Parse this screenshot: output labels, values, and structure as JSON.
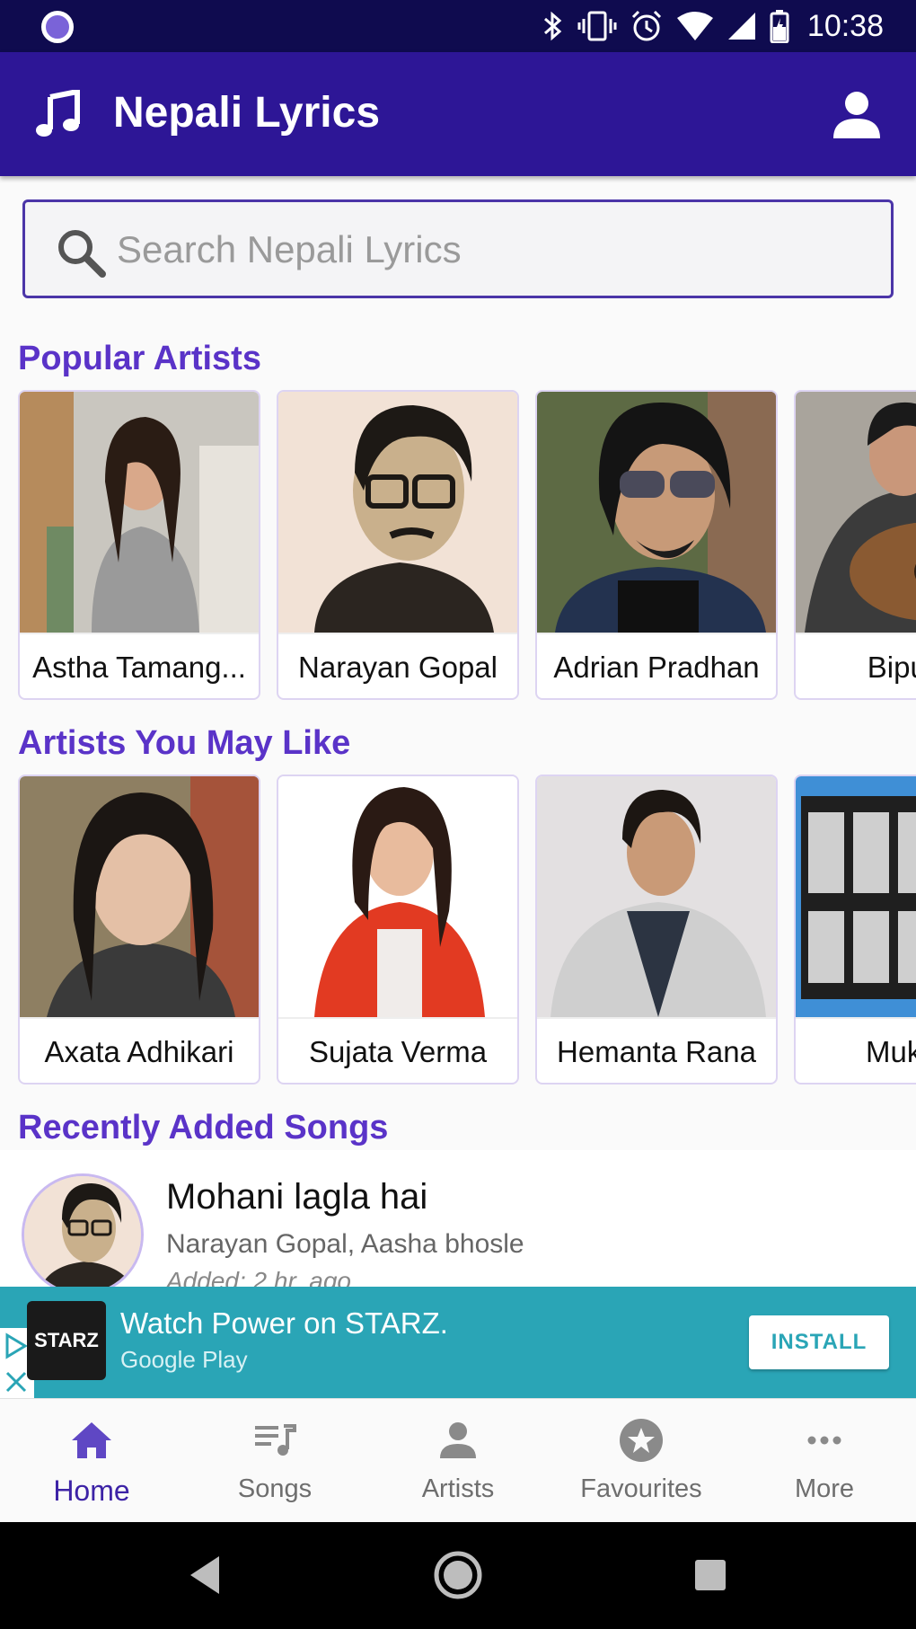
{
  "status_bar": {
    "time": "10:38"
  },
  "app_bar": {
    "title": "Nepali Lyrics"
  },
  "search": {
    "placeholder": "Search Nepali Lyrics"
  },
  "popular_artists": {
    "title": "Popular Artists",
    "items": [
      {
        "name": "Astha Tamang..."
      },
      {
        "name": "Narayan Gopal"
      },
      {
        "name": "Adrian Pradhan"
      },
      {
        "name": "Bipul C"
      }
    ]
  },
  "artists_you_may_like": {
    "title": "Artists You May Like",
    "items": [
      {
        "name": "Axata Adhikari"
      },
      {
        "name": "Sujata Verma"
      },
      {
        "name": "Hemanta Rana"
      },
      {
        "name": "Mukti &"
      }
    ]
  },
  "recently_added": {
    "title": "Recently Added Songs",
    "songs": [
      {
        "title": "Mohani lagla hai",
        "artists": "Narayan Gopal, Aasha bhosle",
        "added": "Added: 2 hr. ago"
      }
    ]
  },
  "ad": {
    "logo_text": "STARZ",
    "title": "Watch Power on STARZ.",
    "subtitle": "Google Play",
    "cta": "INSTALL"
  },
  "bottom_nav": {
    "items": [
      {
        "label": "Home",
        "icon": "home-icon",
        "active": true
      },
      {
        "label": "Songs",
        "icon": "playlist-icon",
        "active": false
      },
      {
        "label": "Artists",
        "icon": "person-icon",
        "active": false
      },
      {
        "label": "Favourites",
        "icon": "star-icon",
        "active": false
      },
      {
        "label": "More",
        "icon": "more-icon",
        "active": false
      }
    ]
  },
  "colors": {
    "status_bar": "#0f0b4f",
    "app_bar": "#2d1696",
    "accent": "#5a33c8",
    "active_nav": "#3d23a6",
    "ad_background": "#2aa5b6"
  }
}
